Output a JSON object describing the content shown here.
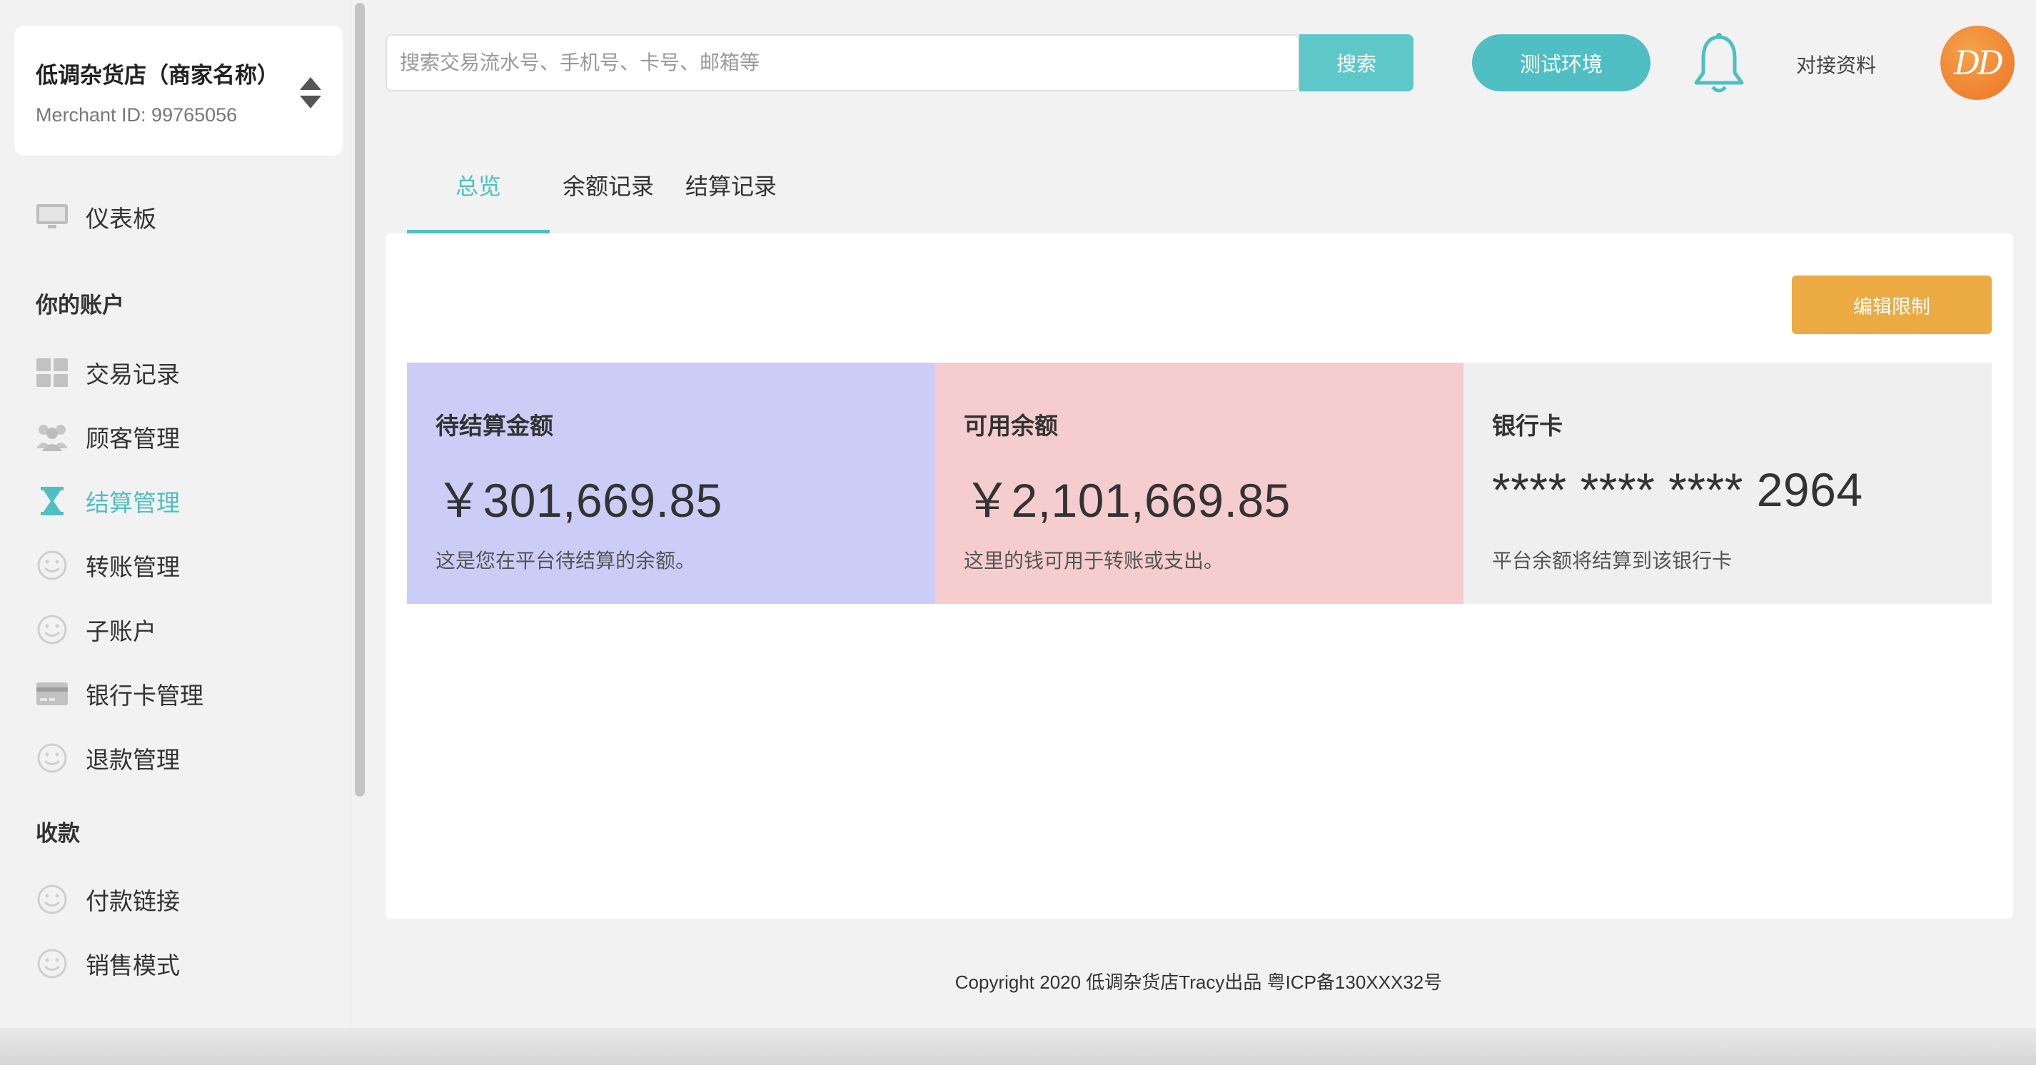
{
  "merchant": {
    "name": "低调杂货店（商家名称）",
    "id_text": "Merchant ID: 99765056"
  },
  "sidebar": {
    "dashboard": {
      "label": "仪表板",
      "icon": "monitor-icon"
    },
    "section_account": "你的账户",
    "account_items": [
      {
        "label": "交易记录",
        "icon": "grid-icon"
      },
      {
        "label": "顾客管理",
        "icon": "users-icon"
      },
      {
        "label": "结算管理",
        "icon": "hourglass-icon",
        "active": true
      },
      {
        "label": "转账管理",
        "icon": "smiley-icon"
      },
      {
        "label": "子账户",
        "icon": "smiley-icon"
      },
      {
        "label": "银行卡管理",
        "icon": "credit-card-icon"
      },
      {
        "label": "退款管理",
        "icon": "smiley-icon"
      }
    ],
    "section_collect": "收款",
    "collect_items": [
      {
        "label": "付款链接",
        "icon": "smiley-icon"
      },
      {
        "label": "销售模式",
        "icon": "smiley-icon"
      }
    ]
  },
  "topbar": {
    "search_placeholder": "搜索交易流水号、手机号、卡号、邮箱等",
    "search_button": "搜索",
    "env_button": "测试环境",
    "docs_link": "对接资料",
    "avatar_text": "DD"
  },
  "tabs": [
    {
      "label": "总览",
      "active": true
    },
    {
      "label": "余额记录"
    },
    {
      "label": "结算记录"
    }
  ],
  "panel": {
    "edit_limit_button": "编辑限制",
    "cards": [
      {
        "title": "待结算金额",
        "amount": "￥301,669.85",
        "desc": "这是您在平台待结算的余额。",
        "bg": "#cbcdf7"
      },
      {
        "title": "可用余额",
        "amount": "￥2,101,669.85",
        "desc": "这里的钱可用于转账或支出。",
        "bg": "#f5cdce"
      },
      {
        "title": "银行卡",
        "amount": "**** **** **** 2964",
        "desc": "平台余额将结算到该银行卡",
        "bg": "#efefef"
      }
    ]
  },
  "footer": "Copyright  2020 低调杂货店Tracy出品  粤ICP备130XXX32号",
  "colors": {
    "accent": "#4fbfc3",
    "search_button": "#5ec8c9",
    "edit_button": "#ecaa43",
    "avatar": "#ec7427"
  }
}
